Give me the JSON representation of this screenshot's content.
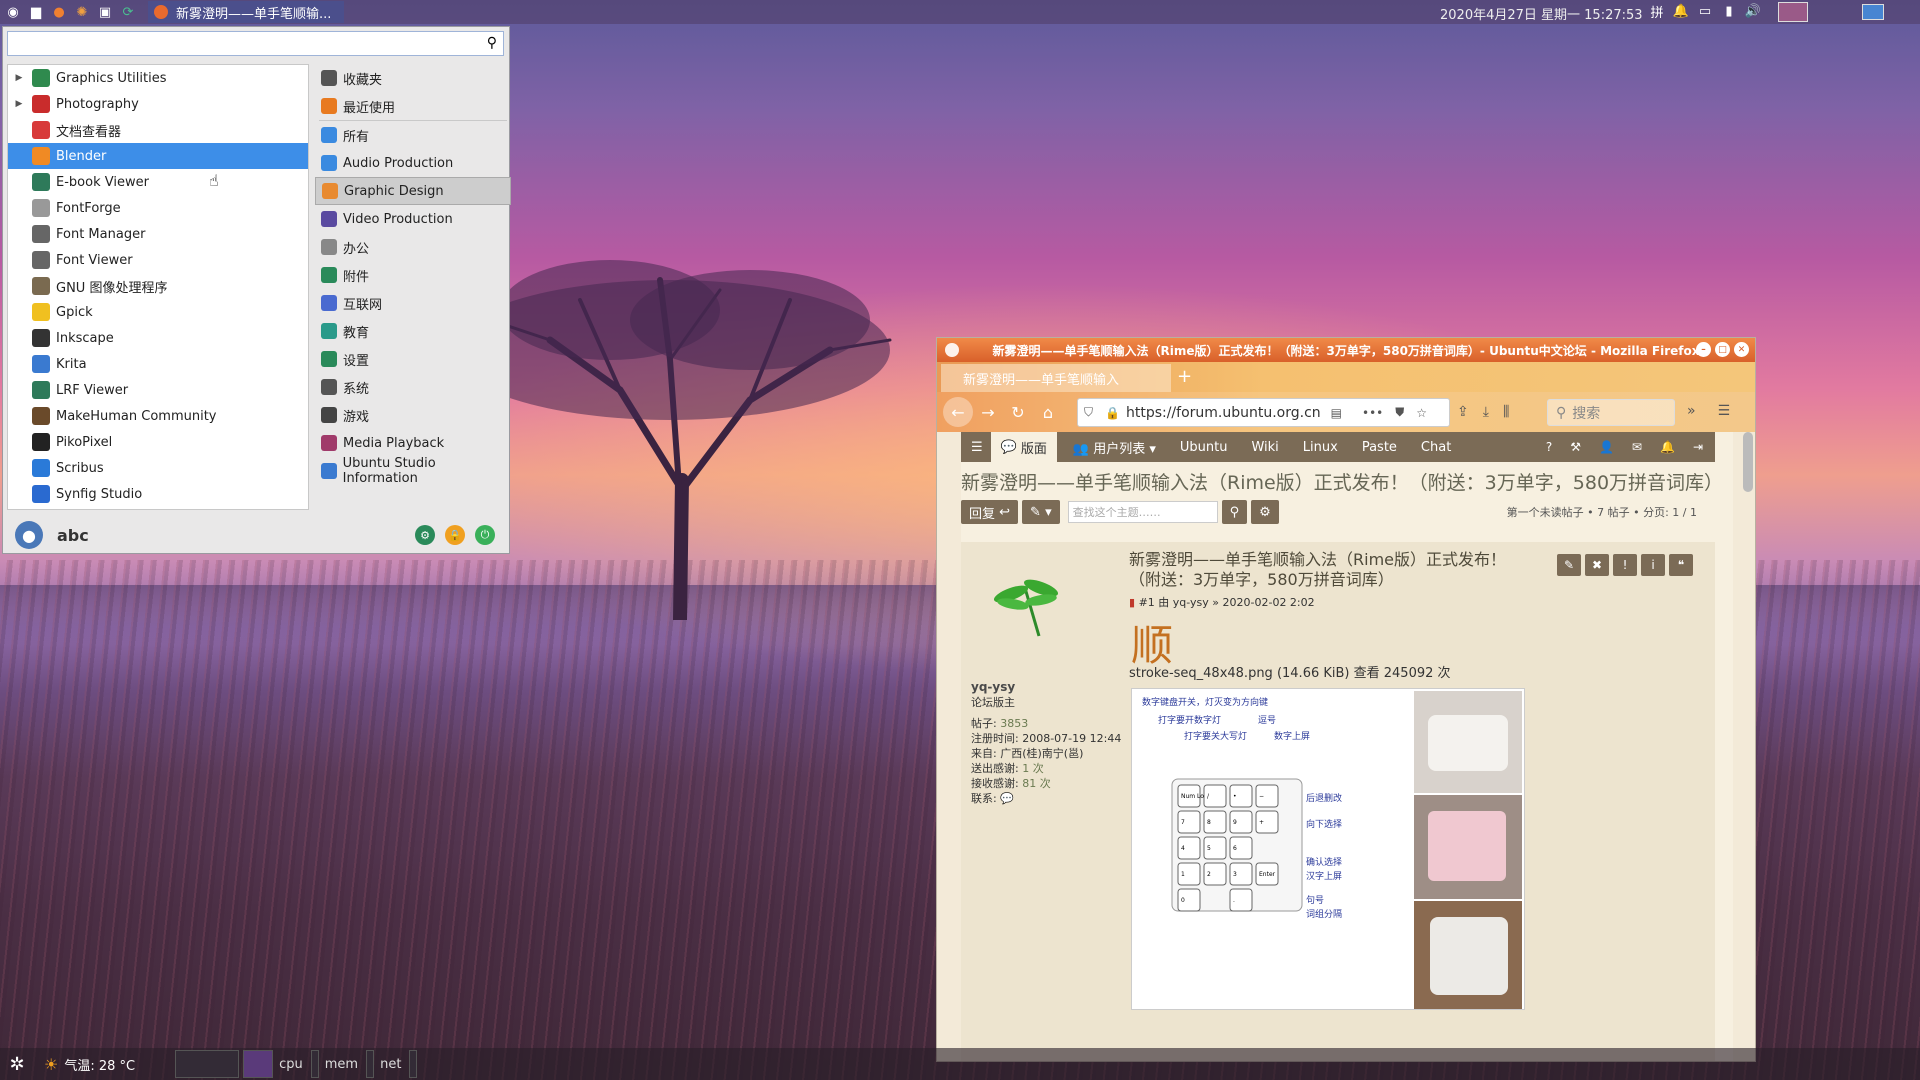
{
  "top_panel": {
    "active_task": "新雾澄明——单手笔顺输...",
    "clock": "2020年4月27日 星期一 15:27:53"
  },
  "menu": {
    "search": {
      "value": "",
      "placeholder": ""
    },
    "apps": [
      {
        "label": "Graphics Utilities",
        "expandable": true,
        "icon": "graphics-utilities-icon",
        "color": "#2f8a4e"
      },
      {
        "label": "Photography",
        "expandable": true,
        "icon": "photography-icon",
        "color": "#c92c2c"
      },
      {
        "label": "文档查看器",
        "expandable": false,
        "icon": "document-viewer-icon",
        "color": "#d83a3a"
      },
      {
        "label": "Blender",
        "expandable": false,
        "icon": "blender-icon",
        "color": "#f08a24",
        "selected": true
      },
      {
        "label": "E-book Viewer",
        "expandable": false,
        "icon": "ebook-viewer-icon",
        "color": "#2e7a5a"
      },
      {
        "label": "FontForge",
        "expandable": false,
        "icon": "fontforge-icon",
        "color": "#999999"
      },
      {
        "label": "Font Manager",
        "expandable": false,
        "icon": "font-manager-icon",
        "color": "#666666"
      },
      {
        "label": "Font Viewer",
        "expandable": false,
        "icon": "font-viewer-icon",
        "color": "#666666"
      },
      {
        "label": "GNU 图像处理程序",
        "expandable": false,
        "icon": "gimp-icon",
        "color": "#7a6a50"
      },
      {
        "label": "Gpick",
        "expandable": false,
        "icon": "gpick-icon",
        "color": "#f0c020"
      },
      {
        "label": "Inkscape",
        "expandable": false,
        "icon": "inkscape-icon",
        "color": "#333333"
      },
      {
        "label": "Krita",
        "expandable": false,
        "icon": "krita-icon",
        "color": "#3a7ad0"
      },
      {
        "label": "LRF Viewer",
        "expandable": false,
        "icon": "lrf-viewer-icon",
        "color": "#2e7a5a"
      },
      {
        "label": "MakeHuman Community",
        "expandable": false,
        "icon": "makehuman-icon",
        "color": "#6a4a2a"
      },
      {
        "label": "PikoPixel",
        "expandable": false,
        "icon": "pikopixel-icon",
        "color": "#222222"
      },
      {
        "label": "Scribus",
        "expandable": false,
        "icon": "scribus-icon",
        "color": "#2a7ad8"
      },
      {
        "label": "Synfig Studio",
        "expandable": false,
        "icon": "synfig-icon",
        "color": "#2a6ad0"
      }
    ],
    "categories": [
      {
        "label": "收藏夹",
        "icon": "star-icon",
        "color": "#555555"
      },
      {
        "label": "最近使用",
        "icon": "recent-icon",
        "color": "#e87a20"
      },
      {
        "label": "所有",
        "icon": "all-icon",
        "color": "#3a8ae0"
      },
      {
        "label": "Audio Production",
        "icon": "audio-production-icon",
        "color": "#3a8ae0"
      },
      {
        "label": "Graphic Design",
        "icon": "graphic-design-icon",
        "color": "#e88a30",
        "selected": true
      },
      {
        "label": "Video Production",
        "icon": "video-production-icon",
        "color": "#5a4aa0"
      },
      {
        "label": "办公",
        "icon": "office-icon",
        "color": "#888888"
      },
      {
        "label": "附件",
        "icon": "accessories-icon",
        "color": "#2a8a5a"
      },
      {
        "label": "互联网",
        "icon": "internet-icon",
        "color": "#4a6ad0"
      },
      {
        "label": "教育",
        "icon": "education-icon",
        "color": "#2a9a8a"
      },
      {
        "label": "设置",
        "icon": "settings-icon",
        "color": "#2a8a5a"
      },
      {
        "label": "系统",
        "icon": "system-icon",
        "color": "#555555"
      },
      {
        "label": "游戏",
        "icon": "games-icon",
        "color": "#444444"
      },
      {
        "label": "Media Playback",
        "icon": "media-playback-icon",
        "color": "#a03a6a"
      },
      {
        "label": "Ubuntu Studio Information",
        "icon": "info-icon",
        "color": "#3a7ad0"
      }
    ],
    "user": "abc"
  },
  "bottom_panel": {
    "weather": "气温: 28 °C",
    "graphs": [
      "cpu",
      "mem",
      "net"
    ]
  },
  "firefox": {
    "window_title": "新雾澄明——单手笔顺输入法（Rime版）正式发布！（附送：3万单字，580万拼音词库）- Ubuntu中文论坛 - Mozilla Firefox",
    "tab_label": "新雾澄明——单手笔顺输入",
    "url": "https://forum.ubuntu.org.cn",
    "search_placeholder": "搜索",
    "forum_nav": {
      "active": "版面",
      "items": [
        "用户列表",
        "Ubuntu",
        "Wiki",
        "Linux",
        "Paste",
        "Chat"
      ]
    },
    "topic_title": "新雾澄明——单手笔顺输入法（Rime版）正式发布！（附送：3万单字，580万拼音词库）",
    "reply_label": "回复",
    "topic_search_placeholder": "查找这个主题……",
    "page_info": "第一个未读帖子 • 7 帖子 • 分页: 1 / 1",
    "post": {
      "title_line1": "新雾澄明——单手笔顺输入法（Rime版）正式发布！",
      "title_line2": "（附送：3万单字，580万拼音词库）",
      "meta": "#1  由 yq-ysy » 2020-02-02 2:02",
      "glyph": "顺",
      "attachment": "stroke-seq_48x48.png (14.66 KiB) 查看 245092 次",
      "author": {
        "name": "yq-ysy",
        "rank": "论坛版主",
        "posts_label": "帖子:",
        "posts": "3853",
        "joined_label": "注册时间:",
        "joined": "2008-07-19 12:44",
        "from_label": "来自:",
        "from": "广西(桂)南宁(邕)",
        "thanks_given_label": "送出感谢:",
        "thanks_given": "1 次",
        "thanks_recv_label": "接收感谢:",
        "thanks_recv": "81 次",
        "contact_label": "联系:"
      },
      "diagram_labels": [
        "数字键盘开关，灯灭变为方向键",
        "打字要开数字灯",
        "逗号",
        "打字要关大写灯",
        "数字上屏",
        "后退删改",
        "向下选择",
        "确认选择",
        "汉字上屏",
        "句号",
        "词组分隔"
      ],
      "keys": [
        "Num Lock",
        "/",
        "•",
        "−",
        "7",
        "8",
        "9",
        "+",
        "4",
        "5",
        "6",
        "1",
        "2",
        "3",
        "Enter",
        "0",
        "."
      ]
    }
  }
}
